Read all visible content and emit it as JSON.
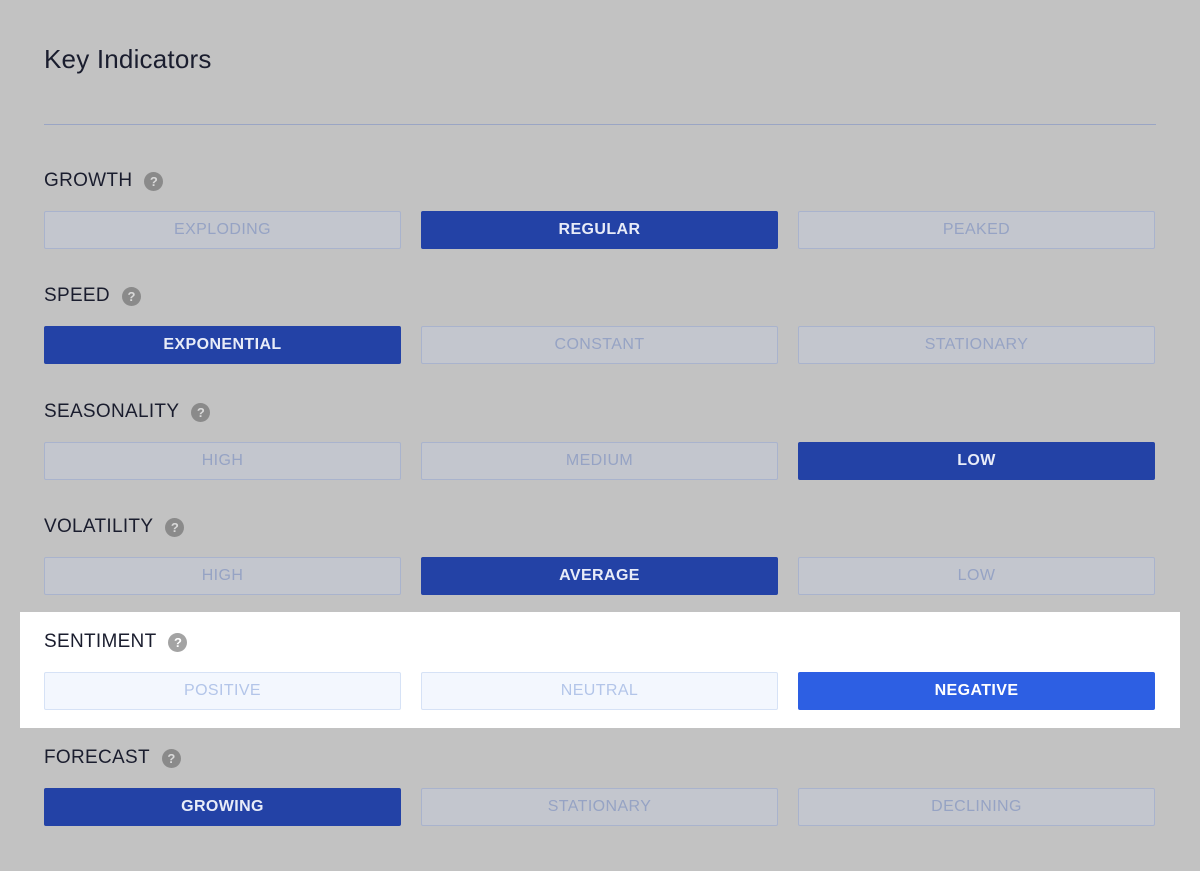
{
  "page": {
    "title": "Key Indicators"
  },
  "indicators": [
    {
      "label": "GROWTH",
      "options": [
        "EXPLODING",
        "REGULAR",
        "PEAKED"
      ],
      "selected": 1,
      "highlighted": false
    },
    {
      "label": "SPEED",
      "options": [
        "EXPONENTIAL",
        "CONSTANT",
        "STATIONARY"
      ],
      "selected": 0,
      "highlighted": false
    },
    {
      "label": "SEASONALITY",
      "options": [
        "HIGH",
        "MEDIUM",
        "LOW"
      ],
      "selected": 2,
      "highlighted": false
    },
    {
      "label": "VOLATILITY",
      "options": [
        "HIGH",
        "AVERAGE",
        "LOW"
      ],
      "selected": 1,
      "highlighted": false
    },
    {
      "label": "SENTIMENT",
      "options": [
        "POSITIVE",
        "NEUTRAL",
        "NEGATIVE"
      ],
      "selected": 2,
      "highlighted": true
    },
    {
      "label": "FORECAST",
      "options": [
        "GROWING",
        "STATIONARY",
        "DECLINING"
      ],
      "selected": 0,
      "highlighted": false
    }
  ],
  "help_icon": {
    "glyph": "?",
    "icon_name": "help-icon"
  },
  "colors": {
    "active": "#2342a6",
    "active_highlighted": "#2d5fe3",
    "overlay": "#c2c2c2"
  }
}
